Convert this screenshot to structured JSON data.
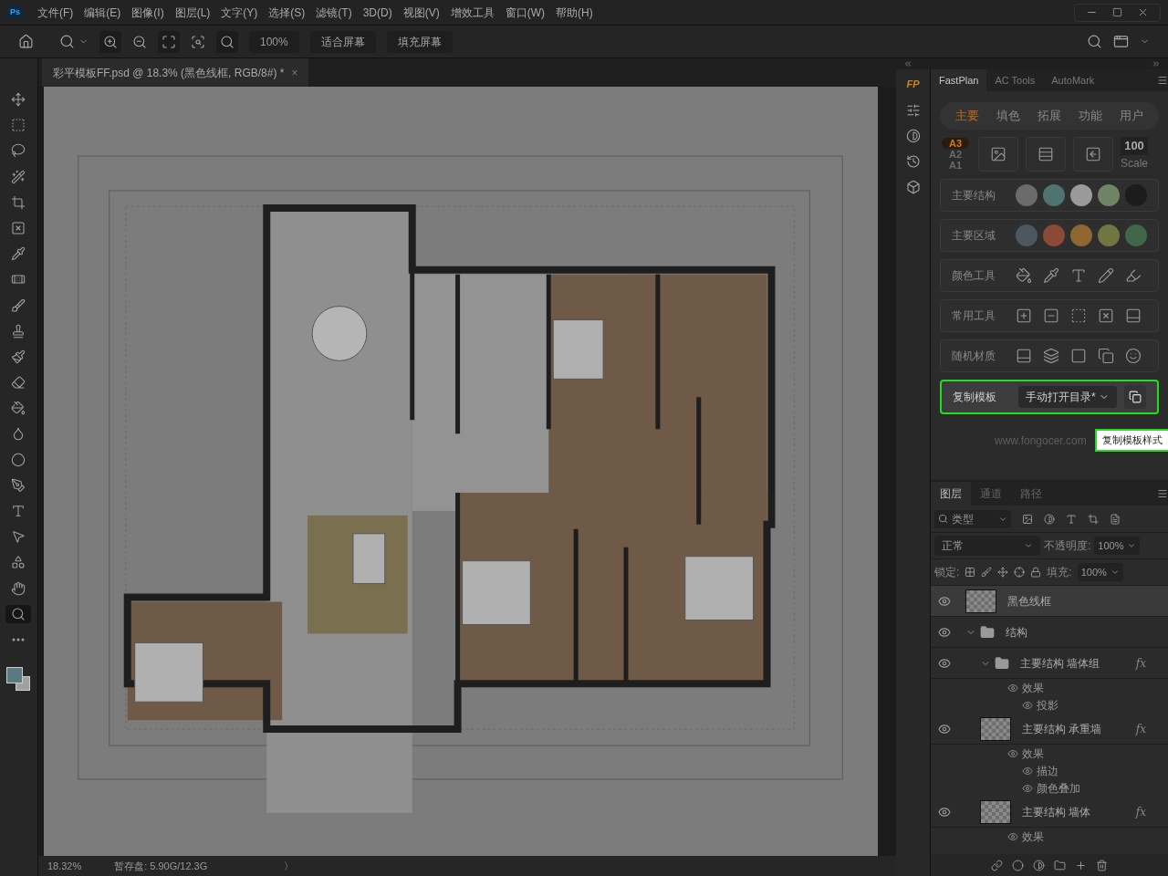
{
  "app": {
    "logo": "Ps",
    "menu": [
      "文件(F)",
      "编辑(E)",
      "图像(I)",
      "图层(L)",
      "文字(Y)",
      "选择(S)",
      "滤镜(T)",
      "3D(D)",
      "视图(V)",
      "增效工具",
      "窗口(W)",
      "帮助(H)"
    ]
  },
  "options_bar": {
    "zoom": "100%",
    "buttons": [
      "适合屏幕",
      "填充屏幕"
    ]
  },
  "tools": [
    {
      "kind": "move",
      "selected": false
    },
    {
      "kind": "marquee",
      "selected": false
    },
    {
      "kind": "lasso",
      "selected": false
    },
    {
      "kind": "wand",
      "selected": false
    },
    {
      "kind": "crop",
      "selected": false
    },
    {
      "kind": "frame",
      "selected": false
    },
    {
      "kind": "eyedropper",
      "selected": false
    },
    {
      "kind": "heal",
      "selected": false
    },
    {
      "kind": "brush",
      "selected": false
    },
    {
      "kind": "stamp",
      "selected": false
    },
    {
      "kind": "history",
      "selected": false
    },
    {
      "kind": "eraser",
      "selected": false
    },
    {
      "kind": "bucket",
      "selected": false
    },
    {
      "kind": "smudge",
      "selected": false
    },
    {
      "kind": "dodge",
      "selected": false
    },
    {
      "kind": "pen",
      "selected": false
    },
    {
      "kind": "type",
      "selected": false
    },
    {
      "kind": "select",
      "selected": false
    },
    {
      "kind": "shape",
      "selected": false
    },
    {
      "kind": "hand",
      "selected": false
    },
    {
      "kind": "zoom",
      "selected": true
    },
    {
      "kind": "more",
      "selected": false
    }
  ],
  "document_tab": {
    "title": "彩平模板FF.psd @ 18.3% (黑色线框, RGB/8#) *",
    "close": "×"
  },
  "status_bar": {
    "zoom": "18.32%",
    "scratch": "暂存盘: 5.90G/12.3G",
    "arrow": "〉"
  },
  "plugin_panel": {
    "logo": "FP",
    "tabs": [
      {
        "label": "FastPlan",
        "selected": true
      },
      {
        "label": "AC Tools",
        "selected": false
      },
      {
        "label": "AutoMark",
        "selected": false
      }
    ],
    "subtabs": [
      {
        "label": "主要",
        "selected": true
      },
      {
        "label": "填色",
        "selected": false
      },
      {
        "label": "拓展",
        "selected": false
      },
      {
        "label": "功能",
        "selected": false
      },
      {
        "label": "用户",
        "selected": false
      }
    ],
    "paper_sizes": [
      {
        "label": "A3",
        "selected": true
      },
      {
        "label": "A2",
        "selected": false
      },
      {
        "label": "A1",
        "selected": false
      }
    ],
    "scale": {
      "value": "100",
      "label": "Scale"
    },
    "swatch_rows": [
      {
        "label": "主要结构",
        "colors": [
          {
            "color": "#6b6b6b"
          },
          {
            "color": "#4e7370"
          },
          {
            "color": "#9a9a9a"
          },
          {
            "color": "#6f8463"
          },
          {
            "color": "#1c1c1c"
          }
        ]
      },
      {
        "label": "主要区域",
        "colors": [
          {
            "color": "#4d5760"
          },
          {
            "color": "#8a4a36"
          },
          {
            "color": "#8d6630"
          },
          {
            "color": "#717640"
          },
          {
            "color": "#41674a"
          }
        ]
      }
    ],
    "tool_rows": [
      {
        "label": "颜色工具",
        "kind": "color"
      },
      {
        "label": "常用工具",
        "kind": "common"
      },
      {
        "label": "随机材质",
        "kind": "material"
      }
    ],
    "template": {
      "label": "复制模板",
      "value": "手动打开目录*",
      "tooltip": "复制模板样式",
      "highlighted": true
    },
    "website": "www.fongocer.com"
  },
  "layers_panel": {
    "tabs": [
      {
        "label": "图层",
        "selected": true
      },
      {
        "label": "通道",
        "selected": false
      },
      {
        "label": "路径",
        "selected": false
      }
    ],
    "filter": "类型",
    "blend_mode": "正常",
    "opacity_label": "不透明度:",
    "opacity": "100%",
    "lock_label": "锁定:",
    "fill_label": "填充:",
    "fill": "100%",
    "layers": [
      {
        "kind": "layer",
        "name": "黑色线框",
        "selected": true,
        "visible": true
      },
      {
        "kind": "group",
        "name": "结构",
        "selected": false,
        "visible": true,
        "expanded": true,
        "children": [
          {
            "kind": "group",
            "name": "主要结构 墙体组",
            "selected": false,
            "visible": true,
            "expanded": true,
            "fx": "fx",
            "effects": [
              {
                "name": "效果",
                "children": [
                  {
                    "name": "投影"
                  }
                ]
              }
            ]
          },
          {
            "kind": "layer",
            "name": "主要结构 承重墙",
            "selected": false,
            "visible": true,
            "fx": "fx",
            "effects": [
              {
                "name": "效果",
                "children": [
                  {
                    "name": "描边"
                  },
                  {
                    "name": "颜色叠加"
                  }
                ]
              }
            ]
          },
          {
            "kind": "layer",
            "name": "主要结构 墙体",
            "selected": false,
            "visible": true,
            "fx": "fx",
            "effects": [
              {
                "name": "效果"
              }
            ]
          }
        ]
      }
    ]
  }
}
